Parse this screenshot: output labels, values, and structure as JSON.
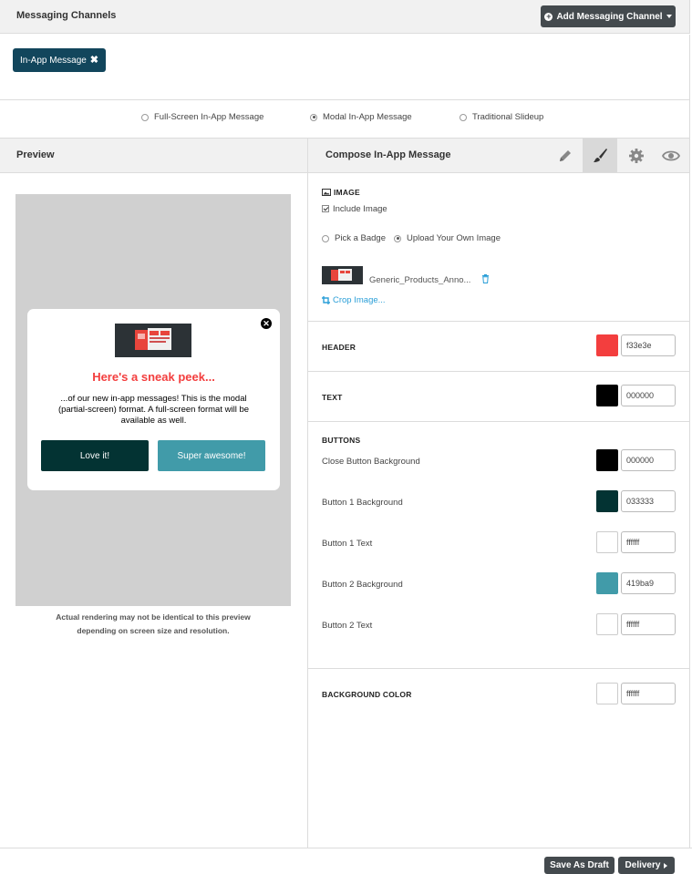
{
  "topbar": {
    "title": "Messaging Channels",
    "add_button_label": "Add Messaging Channel"
  },
  "chips": [
    {
      "label": "In-App Message"
    }
  ],
  "message_types": [
    {
      "label": "Full-Screen In-App Message",
      "selected": false
    },
    {
      "label": "Modal In-App Message",
      "selected": true
    },
    {
      "label": "Traditional Slideup",
      "selected": false
    }
  ],
  "preview": {
    "title": "Preview",
    "modal": {
      "header": "Here's a sneak peek...",
      "text": "...of our new in-app messages! This is the modal (partial-screen) format. A full-screen format will be available as well.",
      "button1": "Love it!",
      "button2": "Super awesome!"
    },
    "note_line1": "Actual rendering may not be identical to this preview",
    "note_line2": "depending on screen size and resolution."
  },
  "compose": {
    "title": "Compose In-App Message",
    "tools": [
      "pencil-icon",
      "brush-icon",
      "gear-icon",
      "eye-icon"
    ],
    "active_tool": "brush-icon"
  },
  "image_section": {
    "title": "IMAGE",
    "include_image_label": "Include Image",
    "include_image_checked": true,
    "options": [
      {
        "label": "Pick a Badge",
        "selected": false
      },
      {
        "label": "Upload Your Own Image",
        "selected": true
      }
    ],
    "file_name": "Generic_Products_Anno...",
    "crop_label": "Crop Image..."
  },
  "header_section": {
    "title": "HEADER",
    "color": "#f33e3e",
    "hex": "f33e3e"
  },
  "text_section": {
    "title": "TEXT",
    "color": "#000000",
    "hex": "000000"
  },
  "buttons_section": {
    "title": "BUTTONS",
    "rows": [
      {
        "label": "Close Button Background",
        "color": "#000000",
        "hex": "000000"
      },
      {
        "label": "Button 1 Background",
        "color": "#033333",
        "hex": "033333"
      },
      {
        "label": "Button 1 Text",
        "color": "#ffffff",
        "hex": "ffffff"
      },
      {
        "label": "Button 2 Background",
        "color": "#419ba9",
        "hex": "419ba9"
      },
      {
        "label": "Button 2 Text",
        "color": "#ffffff",
        "hex": "ffffff"
      }
    ]
  },
  "background_section": {
    "title": "BACKGROUND COLOR",
    "color": "#ffffff",
    "hex": "ffffff"
  },
  "footer": {
    "save_label": "Save As Draft",
    "delivery_label": "Delivery"
  },
  "colors": {
    "chip": "#12465c",
    "dark_button": "#444a4e",
    "link": "#2b9fd8"
  }
}
